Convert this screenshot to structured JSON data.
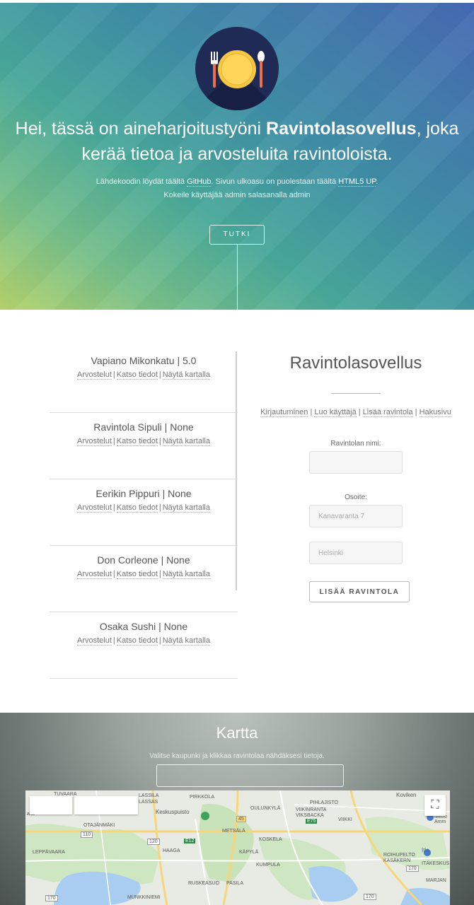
{
  "hero": {
    "title_pre": "Hei, tässä on aineharjoitustyöni ",
    "title_app": "Ravintolasovellus",
    "title_post": ", joka kerää tietoa ja arvosteluita ravintoloista.",
    "sub_line1_pre": "Lähdekoodin löydät täältä ",
    "sub_link_github": "GitHub",
    "sub_line1_mid": ". Sivun ulkoasu on puolestaan täältä ",
    "sub_link_html5up": "HTML5 UP",
    "sub_line1_end": ".",
    "sub_line2": "Kokeile käyttäjää admin salasanalla admin",
    "button": "TUTKI"
  },
  "restaurants": {
    "link_reviews": "Arvostelut",
    "link_details": "Katso tiedot",
    "link_map": "Näytä kartalla",
    "separator": "|",
    "items": [
      {
        "name": "Vapiano Mikonkatu | 5.0"
      },
      {
        "name": "Ravintola Sipuli | None"
      },
      {
        "name": "Eerikin Pippuri | None"
      },
      {
        "name": "Don Corleone | None"
      },
      {
        "name": "Osaka Sushi | None"
      }
    ]
  },
  "form": {
    "title": "Ravintolasovellus",
    "nav": [
      "Kirjautuminen",
      "Luo käyttäjä",
      "Lisää ravintola",
      "Hakusivu"
    ],
    "name_label": "Ravintolan nimi:",
    "address_label": "Osoite:",
    "street_placeholder": "Kanavaranta 7",
    "city_placeholder": "Helsinki",
    "submit": "LISÄÄ RAVINTOLA"
  },
  "map_section": {
    "title": "Kartta",
    "subtitle": "Valitse kaupunki ja klikkaa ravintolaa nähdäksesi tietoja.",
    "labels": {
      "l1": "LASSILA",
      "l2": "LASSAS",
      "l3": "PIRKKOLA",
      "l4": "Keskuspuisto",
      "l5": "OULUNKYLÄ",
      "l6": "PIHLAJISTO",
      "l7": "VIIKINRANTA",
      "l8": "VIKSBACKA",
      "l9": "VIIKKI",
      "l10": "Koviken",
      "l11": "OTAJÄNMÄKI",
      "l12": "METSÄLÄ",
      "l13": "KOSKELA",
      "l14": "LEPPÄVAARA",
      "l15": "HAAGA",
      "l16": "KÄPYLÄ",
      "l17": "KUMPULA",
      "l18": "RUSKEASUO",
      "l19": "PASILA",
      "l20": "MUNKKINIEMI",
      "l21": "ROIHUPELTO",
      "l22": "KASÄKERN",
      "l23": "ITÄKESKUS",
      "l24": "MARJAN",
      "l25": "Itis",
      "l26": "Metro Amm",
      "l27": "TUVAARA",
      "l28": "aila"
    },
    "roads": {
      "r1": "110",
      "r2": "120",
      "r3": "E12",
      "r4": "45",
      "r5": "E75",
      "r6": "170",
      "r7": "170",
      "r8": "170"
    }
  },
  "colors": {
    "hero_start": "#b6d36b",
    "hero_end": "#4669b3",
    "logo_bg": "#1f2a55",
    "plate": "#f6c744"
  }
}
